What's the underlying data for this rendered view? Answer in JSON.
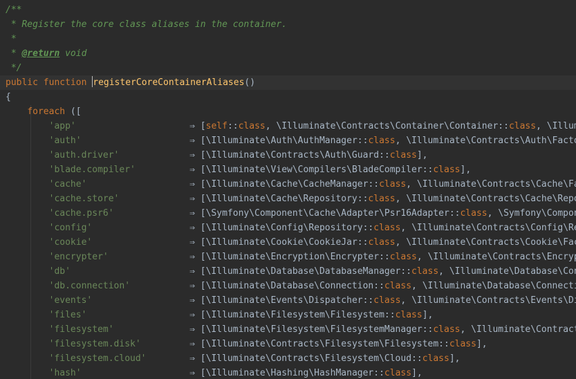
{
  "docblock": {
    "open": "/**",
    "summary": " * Register the core class aliases in the container.",
    "blank": " *",
    "return_prefix": " * ",
    "return_tag": "@return",
    "return_type": " void",
    "close": " */"
  },
  "signature": {
    "modifier": "public",
    "keyword": "function",
    "name": "registerCoreContainerAliases",
    "params": "()"
  },
  "open_brace": "{",
  "loop": {
    "keyword": "foreach",
    "open": " (["
  },
  "arrow": "⇒",
  "aliases": [
    {
      "key": "'app'",
      "value_parts": [
        [
          "kw",
          "self"
        ],
        [
          "dbl",
          "::"
        ],
        [
          "kw",
          "class"
        ],
        [
          "brk",
          ", "
        ],
        [
          "cls",
          "\\Illuminate\\Contracts\\Container\\Container"
        ],
        [
          "dbl",
          "::"
        ],
        [
          "kw",
          "class"
        ],
        [
          "brk",
          ", "
        ],
        [
          "cls",
          "\\Illuminate\\Contracts\\Container\\Container"
        ]
      ]
    },
    {
      "key": "'auth'",
      "value_parts": [
        [
          "cls",
          "\\Illuminate\\Auth\\AuthManager"
        ],
        [
          "dbl",
          "::"
        ],
        [
          "kw",
          "class"
        ],
        [
          "brk",
          ", "
        ],
        [
          "cls",
          "\\Illuminate\\Contracts\\Auth\\Factory"
        ]
      ]
    },
    {
      "key": "'auth.driver'",
      "value_parts": [
        [
          "cls",
          "\\Illuminate\\Contracts\\Auth\\Guard"
        ],
        [
          "dbl",
          "::"
        ],
        [
          "kw",
          "class"
        ],
        [
          "brk",
          "],"
        ]
      ]
    },
    {
      "key": "'blade.compiler'",
      "value_parts": [
        [
          "cls",
          "\\Illuminate\\View\\Compilers\\BladeCompiler"
        ],
        [
          "dbl",
          "::"
        ],
        [
          "kw",
          "class"
        ],
        [
          "brk",
          "],"
        ]
      ]
    },
    {
      "key": "'cache'",
      "value_parts": [
        [
          "cls",
          "\\Illuminate\\Cache\\CacheManager"
        ],
        [
          "dbl",
          "::"
        ],
        [
          "kw",
          "class"
        ],
        [
          "brk",
          ", "
        ],
        [
          "cls",
          "\\Illuminate\\Contracts\\Cache\\Factory"
        ]
      ]
    },
    {
      "key": "'cache.store'",
      "value_parts": [
        [
          "cls",
          "\\Illuminate\\Cache\\Repository"
        ],
        [
          "dbl",
          "::"
        ],
        [
          "kw",
          "class"
        ],
        [
          "brk",
          ", "
        ],
        [
          "cls",
          "\\Illuminate\\Contracts\\Cache\\Repository"
        ]
      ]
    },
    {
      "key": "'cache.psr6'",
      "value_parts": [
        [
          "cls",
          "\\Symfony\\Component\\Cache\\Adapter\\Psr16Adapter"
        ],
        [
          "dbl",
          "::"
        ],
        [
          "kw",
          "class"
        ],
        [
          "brk",
          ", "
        ],
        [
          "cls",
          "\\Symfony\\Component\\Cache\\Adapter"
        ]
      ]
    },
    {
      "key": "'config'",
      "value_parts": [
        [
          "cls",
          "\\Illuminate\\Config\\Repository"
        ],
        [
          "dbl",
          "::"
        ],
        [
          "kw",
          "class"
        ],
        [
          "brk",
          ", "
        ],
        [
          "cls",
          "\\Illuminate\\Contracts\\Config\\Repository"
        ]
      ]
    },
    {
      "key": "'cookie'",
      "value_parts": [
        [
          "cls",
          "\\Illuminate\\Cookie\\CookieJar"
        ],
        [
          "dbl",
          "::"
        ],
        [
          "kw",
          "class"
        ],
        [
          "brk",
          ", "
        ],
        [
          "cls",
          "\\Illuminate\\Contracts\\Cookie\\Factory"
        ]
      ]
    },
    {
      "key": "'encrypter'",
      "value_parts": [
        [
          "cls",
          "\\Illuminate\\Encryption\\Encrypter"
        ],
        [
          "dbl",
          "::"
        ],
        [
          "kw",
          "class"
        ],
        [
          "brk",
          ", "
        ],
        [
          "cls",
          "\\Illuminate\\Contracts\\Encryption"
        ]
      ]
    },
    {
      "key": "'db'",
      "value_parts": [
        [
          "cls",
          "\\Illuminate\\Database\\DatabaseManager"
        ],
        [
          "dbl",
          "::"
        ],
        [
          "kw",
          "class"
        ],
        [
          "brk",
          ", "
        ],
        [
          "cls",
          "\\Illuminate\\Database\\ConnectionResolver"
        ]
      ]
    },
    {
      "key": "'db.connection'",
      "value_parts": [
        [
          "cls",
          "\\Illuminate\\Database\\Connection"
        ],
        [
          "dbl",
          "::"
        ],
        [
          "kw",
          "class"
        ],
        [
          "brk",
          ", "
        ],
        [
          "cls",
          "\\Illuminate\\Database\\ConnectionInterface"
        ]
      ]
    },
    {
      "key": "'events'",
      "value_parts": [
        [
          "cls",
          "\\Illuminate\\Events\\Dispatcher"
        ],
        [
          "dbl",
          "::"
        ],
        [
          "kw",
          "class"
        ],
        [
          "brk",
          ", "
        ],
        [
          "cls",
          "\\Illuminate\\Contracts\\Events\\Dispatcher"
        ]
      ]
    },
    {
      "key": "'files'",
      "value_parts": [
        [
          "cls",
          "\\Illuminate\\Filesystem\\Filesystem"
        ],
        [
          "dbl",
          "::"
        ],
        [
          "kw",
          "class"
        ],
        [
          "brk",
          "],"
        ]
      ]
    },
    {
      "key": "'filesystem'",
      "value_parts": [
        [
          "cls",
          "\\Illuminate\\Filesystem\\FilesystemManager"
        ],
        [
          "dbl",
          "::"
        ],
        [
          "kw",
          "class"
        ],
        [
          "brk",
          ", "
        ],
        [
          "cls",
          "\\Illuminate\\Contracts\\Filesystem"
        ]
      ]
    },
    {
      "key": "'filesystem.disk'",
      "value_parts": [
        [
          "cls",
          "\\Illuminate\\Contracts\\Filesystem\\Filesystem"
        ],
        [
          "dbl",
          "::"
        ],
        [
          "kw",
          "class"
        ],
        [
          "brk",
          "],"
        ]
      ]
    },
    {
      "key": "'filesystem.cloud'",
      "value_parts": [
        [
          "cls",
          "\\Illuminate\\Contracts\\Filesystem\\Cloud"
        ],
        [
          "dbl",
          "::"
        ],
        [
          "kw",
          "class"
        ],
        [
          "brk",
          "],"
        ]
      ]
    },
    {
      "key": "'hash'",
      "value_parts": [
        [
          "cls",
          "\\Illuminate\\Hashing\\HashManager"
        ],
        [
          "dbl",
          "::"
        ],
        [
          "kw",
          "class"
        ],
        [
          "brk",
          "],"
        ]
      ]
    }
  ]
}
